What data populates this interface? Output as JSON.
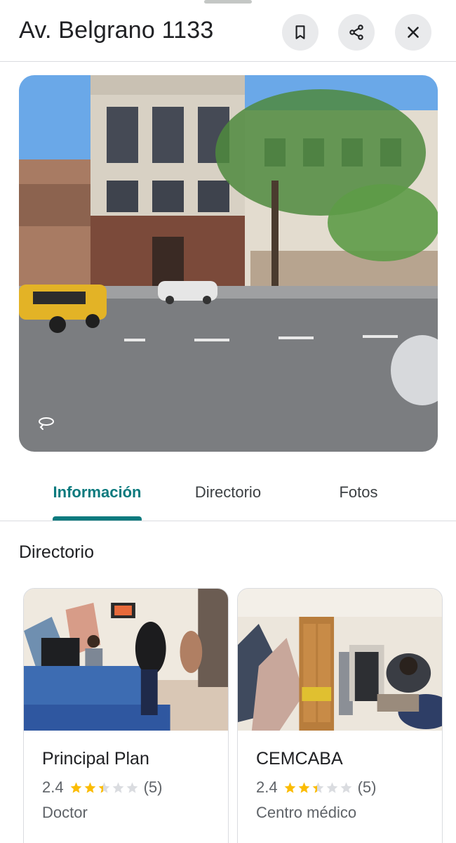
{
  "header": {
    "title": "Av. Belgrano 1133",
    "buttons": [
      {
        "name": "save",
        "icon": "bookmark-icon"
      },
      {
        "name": "share",
        "icon": "share-icon"
      },
      {
        "name": "close",
        "icon": "close-icon"
      }
    ]
  },
  "photo": {
    "overlay_icon": "rotate-360-icon"
  },
  "tabs": [
    {
      "label": "Información",
      "active": true
    },
    {
      "label": "Directorio",
      "active": false
    },
    {
      "label": "Fotos",
      "active": false
    }
  ],
  "directory": {
    "title": "Directorio",
    "items": [
      {
        "name": "Principal Plan",
        "rating": "2.4",
        "reviews": "(5)",
        "category": "Doctor",
        "stars_filled": 2.4
      },
      {
        "name": "CEMCABA",
        "rating": "2.4",
        "reviews": "(5)",
        "category": "Centro médico",
        "stars_filled": 2.4
      }
    ]
  },
  "colors": {
    "accent": "#0b7a7e",
    "star": "#fbbc04",
    "star_empty": "#dadce0"
  }
}
